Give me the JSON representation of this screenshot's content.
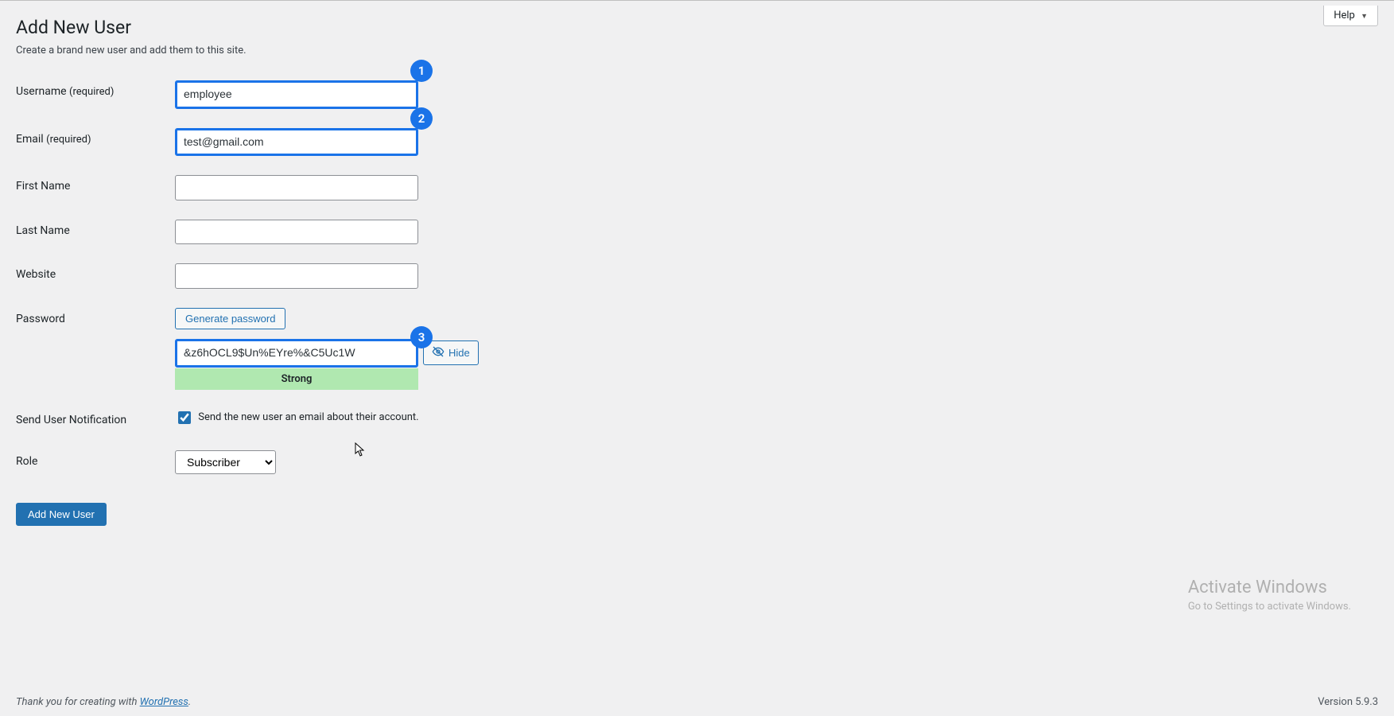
{
  "help_label": "Help",
  "page_title": "Add New User",
  "subtitle": "Create a brand new user and add them to this site.",
  "labels": {
    "username": "Username",
    "email": "Email",
    "required": "(required)",
    "first_name": "First Name",
    "last_name": "Last Name",
    "website": "Website",
    "password": "Password",
    "send_notification": "Send User Notification",
    "role": "Role"
  },
  "values": {
    "username": "employee",
    "email": "test@gmail.com",
    "first_name": "",
    "last_name": "",
    "website": "",
    "password": "&z6hOCL9$Un%EYre%&C5Uc1W",
    "send_notification_checked": true,
    "role_selected": "Subscriber"
  },
  "buttons": {
    "generate_password": "Generate password",
    "hide": "Hide",
    "submit": "Add New User"
  },
  "password_strength": "Strong",
  "checkbox_text": "Send the new user an email about their account.",
  "callouts": {
    "c1": "1",
    "c2": "2",
    "c3": "3"
  },
  "footer": {
    "prefix": "Thank you for creating with ",
    "link_text": "WordPress",
    "suffix": ".",
    "version": "Version 5.9.3"
  },
  "watermark": {
    "line1": "Activate Windows",
    "line2": "Go to Settings to activate Windows."
  }
}
